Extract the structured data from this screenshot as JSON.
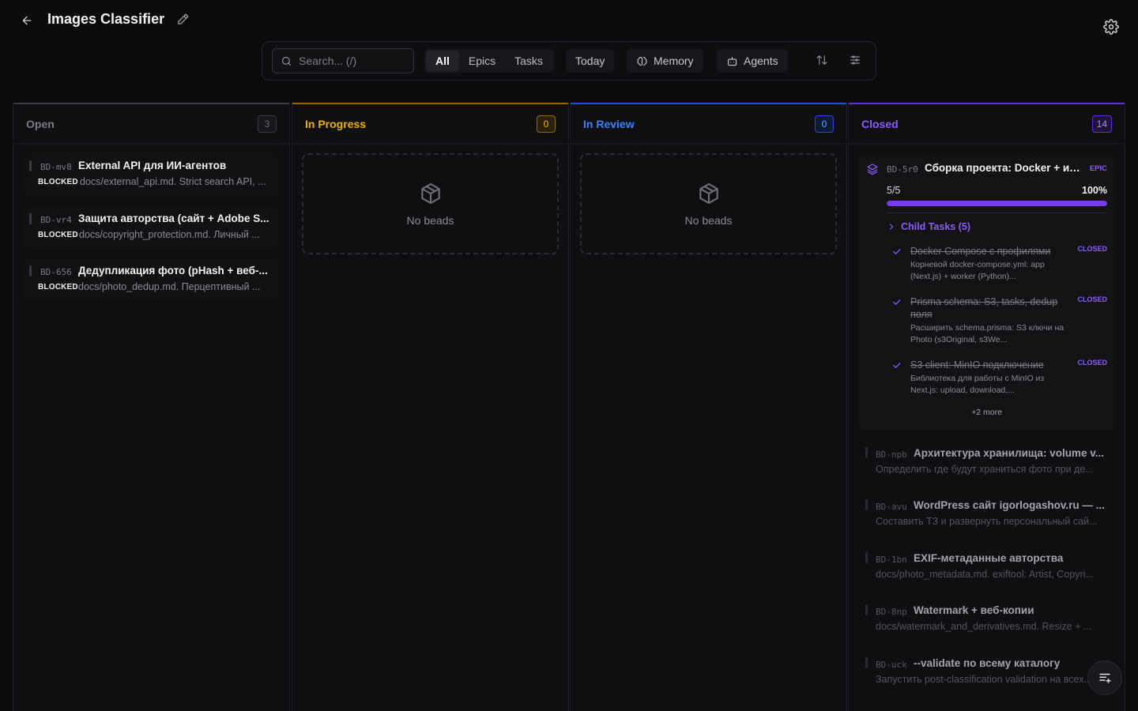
{
  "header": {
    "title": "Images Classifier"
  },
  "toolbar": {
    "search_placeholder": "Search... (/)",
    "filters": [
      "All",
      "Epics",
      "Tasks"
    ],
    "active_filter": "All",
    "today": "Today",
    "memory": "Memory",
    "agents": "Agents"
  },
  "columns": {
    "open": {
      "title": "Open",
      "count": "3",
      "color": "#6b6b72"
    },
    "in_progress": {
      "title": "In Progress",
      "count": "0",
      "color": "#eab308"
    },
    "in_review": {
      "title": "In Review",
      "count": "0",
      "color": "#3b82f6"
    },
    "closed": {
      "title": "Closed",
      "count": "14",
      "color": "#8b5cf6"
    }
  },
  "empty_text": "No beads",
  "open_cards": [
    {
      "id": "BD-mv8",
      "title": "External API для ИИ-агентов",
      "status": "BLOCKED",
      "desc": "docs/external_api.md. Strict search API, ..."
    },
    {
      "id": "BD-vr4",
      "title": "Защита авторства (сайт + Adobe S...",
      "status": "BLOCKED",
      "desc": "docs/copyright_protection.md. Личный ..."
    },
    {
      "id": "BD-656",
      "title": "Дедупликация фото (pHash + веб-...",
      "status": "BLOCKED",
      "desc": "docs/photo_dedup.md. Перцептивный ..."
    }
  ],
  "epic": {
    "id": "BD-5r0",
    "title": "Сборка проекта: Docker + ин...",
    "badge": "EPIC",
    "progress_text": "5/5",
    "progress_pct": "100%",
    "progress": 1.0,
    "child_toggle": "Child Tasks (5)",
    "children": [
      {
        "title": "Docker Compose с профилями",
        "desc": "Корневой docker-compose.yml: app (Next.js) + worker (Python)...",
        "status": "CLOSED"
      },
      {
        "title": "Prisma schema: S3, tasks, dedup поля",
        "desc": "Расширить schema.prisma: S3 ключи на Photo (s3Original, s3We...",
        "status": "CLOSED"
      },
      {
        "title": "S3 client: MinIO подключение",
        "desc": "Библиотека для работы с MinIO из Next.js: upload, download,...",
        "status": "CLOSED"
      }
    ],
    "more": "+2 more"
  },
  "closed_cards": [
    {
      "id": "BD-npb",
      "title": "Архитектура хранилища: volume v...",
      "desc": "Определить где будут храниться фото при де..."
    },
    {
      "id": "BD-avu",
      "title": "WordPress сайт igorlogashov.ru — ...",
      "desc": "Составить ТЗ и развернуть персональный сай..."
    },
    {
      "id": "BD-1bn",
      "title": "EXIF-метаданные авторства",
      "desc": "docs/photo_metadata.md. exiftool: Artist, Copyri..."
    },
    {
      "id": "BD-8np",
      "title": "Watermark + веб-копии",
      "desc": "docs/watermark_and_derivatives.md. Resize + ..."
    },
    {
      "id": "BD-uck",
      "title": "--validate по всему каталогу",
      "desc": "Запустить post-classification validation на всех..."
    }
  ]
}
